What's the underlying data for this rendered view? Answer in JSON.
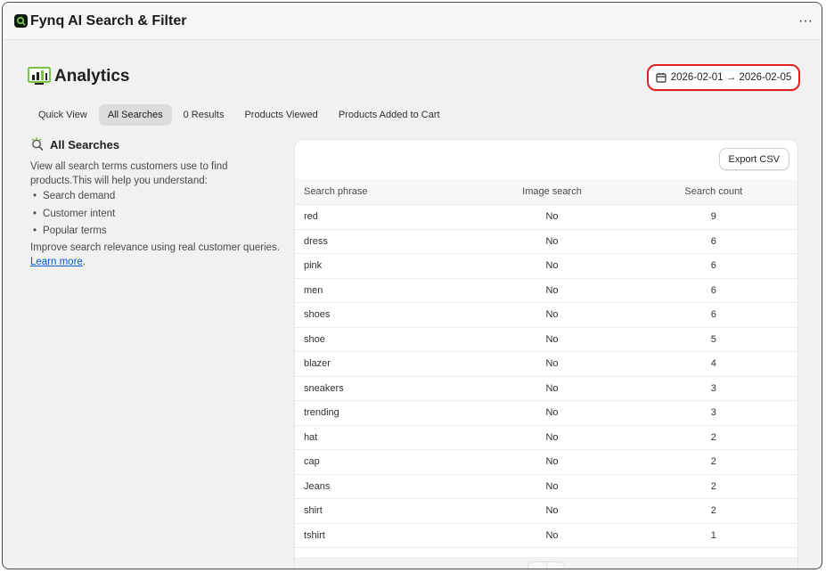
{
  "app": {
    "title": "Fynq AI Search & Filter",
    "more_label": "···"
  },
  "page": {
    "title": "Analytics"
  },
  "date_range": {
    "label": "2026-02-01 → 2026-02-05"
  },
  "tabs": [
    {
      "label": "Quick View",
      "active": false
    },
    {
      "label": "All Searches",
      "active": true
    },
    {
      "label": "0 Results",
      "active": false
    },
    {
      "label": "Products Viewed",
      "active": false
    },
    {
      "label": "Products Added to Cart",
      "active": false
    }
  ],
  "sidebar": {
    "title": "All Searches",
    "intro": "View all search terms customers use to find products.This will help you understand:",
    "bullets": [
      "Search demand",
      "Customer intent",
      "Popular terms"
    ],
    "footer": "Improve search relevance using real customer queries.",
    "link_label": "Learn more",
    "link_suffix": "."
  },
  "table": {
    "export_label": "Export CSV",
    "columns": [
      "Search phrase",
      "Image search",
      "Search count"
    ],
    "rows": [
      [
        "red",
        "No",
        "9"
      ],
      [
        "dress",
        "No",
        "6"
      ],
      [
        "pink",
        "No",
        "6"
      ],
      [
        "men",
        "No",
        "6"
      ],
      [
        "shoes",
        "No",
        "6"
      ],
      [
        "shoe",
        "No",
        "5"
      ],
      [
        "blazer",
        "No",
        "4"
      ],
      [
        "sneakers",
        "No",
        "3"
      ],
      [
        "trending",
        "No",
        "3"
      ],
      [
        "hat",
        "No",
        "2"
      ],
      [
        "cap",
        "No",
        "2"
      ],
      [
        "Jeans",
        "No",
        "2"
      ],
      [
        "shirt",
        "No",
        "2"
      ],
      [
        "tshirt",
        "No",
        "1"
      ]
    ]
  },
  "pager": {
    "prev": "‹",
    "next": "›"
  },
  "colors": {
    "accent_red": "#e02020",
    "link": "#005bd3",
    "brand": "#7cc242"
  }
}
